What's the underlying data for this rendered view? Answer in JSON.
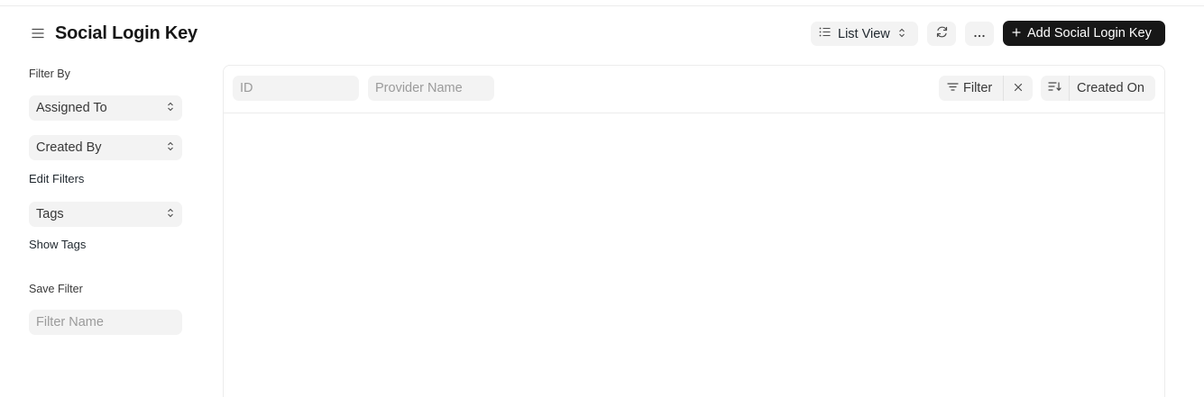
{
  "header": {
    "title": "Social Login Key",
    "view_switcher_label": "List View",
    "add_button_label": "Add Social Login Key"
  },
  "icons": {
    "menu": "hamburger-icon",
    "list": "list-icon",
    "chevron": "chevron-up-down-icon",
    "reload": "refresh-icon",
    "more": "ellipsis-icon",
    "add": "plus-icon",
    "filter": "filter-icon",
    "clear": "close-icon",
    "sort": "sort-descending-icon"
  },
  "sidebar": {
    "filter_by_label": "Filter By",
    "assigned_to_label": "Assigned To",
    "created_by_label": "Created By",
    "edit_filters_label": "Edit Filters",
    "tags_label": "Tags",
    "show_tags_label": "Show Tags",
    "save_filter_label": "Save Filter",
    "filter_name_placeholder": "Filter Name"
  },
  "list": {
    "id_placeholder": "ID",
    "provider_placeholder": "Provider Name",
    "filter_label": "Filter",
    "sort_field_label": "Created On"
  },
  "colors": {
    "primary_button": "#171717",
    "control_bg": "#f3f3f3",
    "border": "#ececec"
  }
}
